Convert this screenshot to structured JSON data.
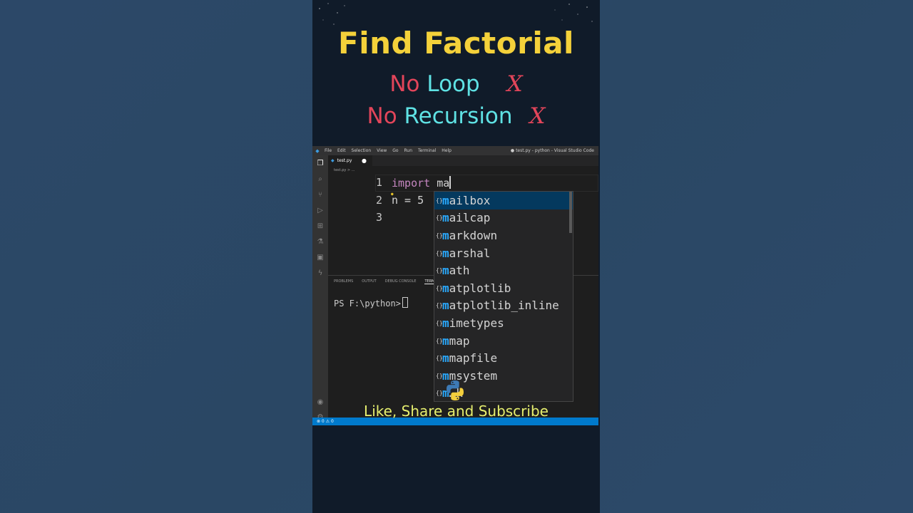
{
  "overlay": {
    "title": "Find Factorial",
    "line1_no": "No",
    "line1_word": "Loop",
    "line2_no": "No",
    "line2_word": "Recursion",
    "x_mark": "X",
    "subscribe": "Like, Share and Subscribe"
  },
  "vscode": {
    "menu": [
      "File",
      "Edit",
      "Selection",
      "View",
      "Go",
      "Run",
      "Terminal",
      "Help"
    ],
    "window_title": "● test.py - python - Visual Studio Code",
    "tab_label": "test.py",
    "tab_modified": "●",
    "breadcrumb": "test.py > ...",
    "editor": {
      "line_numbers": [
        "1",
        "2",
        "3"
      ],
      "line1_keyword": "import",
      "line1_rest": " ma",
      "line2": "n = 5"
    },
    "suggestions": [
      {
        "match": "m",
        "rest": "ailbox"
      },
      {
        "match": "m",
        "rest": "ailcap"
      },
      {
        "match": "m",
        "rest": "arkdown"
      },
      {
        "match": "m",
        "rest": "arshal"
      },
      {
        "match": "m",
        "rest": "ath"
      },
      {
        "match": "m",
        "rest": "atplotlib"
      },
      {
        "match": "m",
        "rest": "atplotlib_inline"
      },
      {
        "match": "m",
        "rest": "imetypes"
      },
      {
        "match": "m",
        "rest": "map"
      },
      {
        "match": "m",
        "rest": "mapfile"
      },
      {
        "match": "m",
        "rest": "msystem"
      },
      {
        "match": "m",
        "rest": "…k"
      }
    ],
    "panel_tabs": [
      "PROBLEMS",
      "OUTPUT",
      "DEBUG CONSOLE",
      "TERMINAL"
    ],
    "terminal_prompt": "PS F:\\python>",
    "status_text": "⊗ 0 ⚠ 0"
  },
  "colors": {
    "title": "#f4d13a",
    "no_red": "#e2455a",
    "word_cyan": "#5fe2e4",
    "status_blue": "#007acc",
    "subscribe": "#e6ef6f"
  }
}
